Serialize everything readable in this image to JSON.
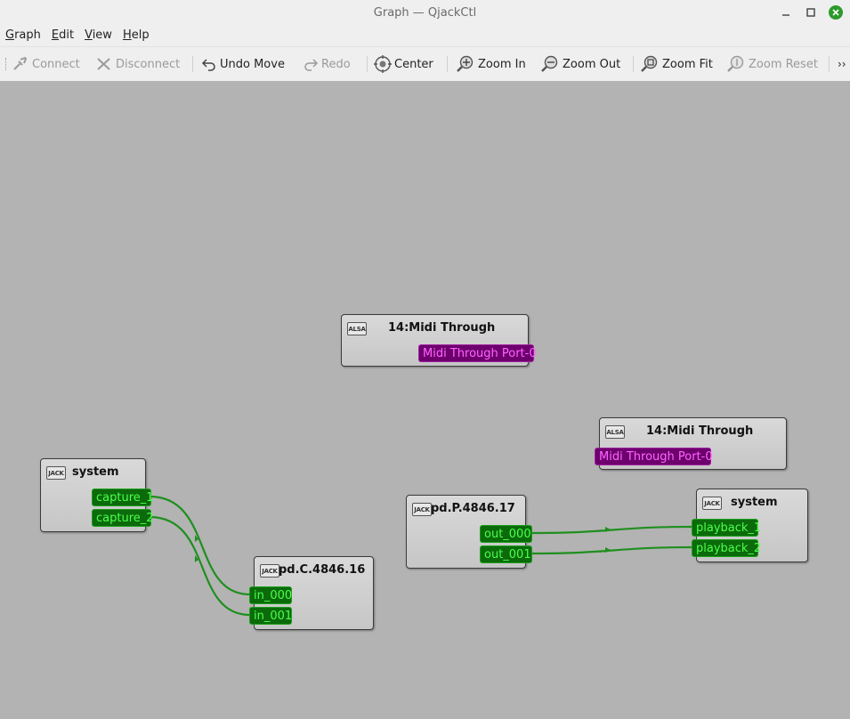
{
  "window": {
    "title": "Graph — QjackCtl",
    "minimize_icon": "minimize-icon",
    "maximize_icon": "maximize-icon",
    "close_icon": "close-icon"
  },
  "menubar": {
    "items": [
      {
        "label": "Graph",
        "accel": "G"
      },
      {
        "label": "Edit",
        "accel": "E"
      },
      {
        "label": "View",
        "accel": "V"
      },
      {
        "label": "Help",
        "accel": "H"
      }
    ]
  },
  "toolbar": {
    "connect": "Connect",
    "disconnect": "Disconnect",
    "undo_move": "Undo Move",
    "redo": "Redo",
    "center": "Center",
    "zoom_in": "Zoom In",
    "zoom_out": "Zoom Out",
    "zoom_fit": "Zoom Fit",
    "zoom_reset": "Zoom Reset",
    "overflow": "››"
  },
  "graph": {
    "nodes": {
      "midi_through_1": {
        "title": "14:Midi Through",
        "badge": "ALSA",
        "ports": [
          "Midi Through Port-0"
        ]
      },
      "midi_through_2": {
        "title": "14:Midi Through",
        "badge": "ALSA",
        "ports": [
          "Midi Through Port-0"
        ]
      },
      "system_capture": {
        "title": "system",
        "badge": "JACK",
        "ports": [
          "capture_1",
          "capture_2"
        ]
      },
      "pd_c": {
        "title": "pd.C.4846.16",
        "badge": "JACK",
        "ports": [
          "in_000",
          "in_001"
        ]
      },
      "pd_p": {
        "title": "pd.P.4846.17",
        "badge": "JACK",
        "ports": [
          "out_000",
          "out_001"
        ]
      },
      "system_playback": {
        "title": "system",
        "badge": "JACK",
        "ports": [
          "playback_1",
          "playback_2"
        ]
      }
    },
    "connections": [
      [
        "system:capture_1",
        "pd.C.4846.16:in_000"
      ],
      [
        "system:capture_2",
        "pd.C.4846.16:in_001"
      ],
      [
        "pd.P.4846.17:out_000",
        "system:playback_1"
      ],
      [
        "pd.P.4846.17:out_001",
        "system:playback_2"
      ]
    ],
    "colors": {
      "audio": "#1c9e1c",
      "midi": "#a020a0",
      "wire": "#1f8f1f"
    }
  }
}
